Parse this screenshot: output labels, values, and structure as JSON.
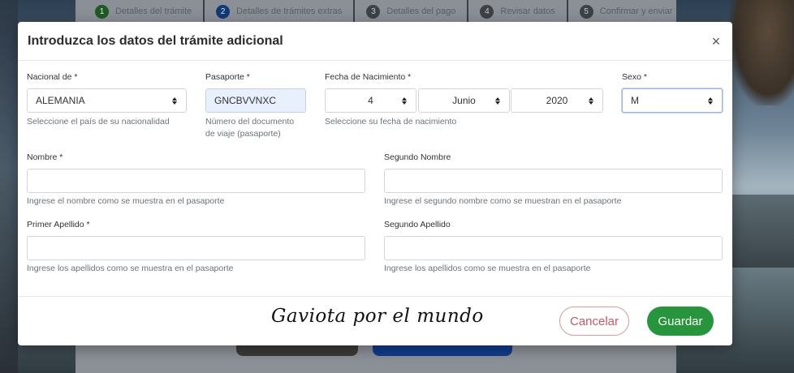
{
  "steps": [
    {
      "num": "1",
      "label": "Detalles del trámite"
    },
    {
      "num": "2",
      "label": "Detalles de trámites extras"
    },
    {
      "num": "3",
      "label": "Detalles del pago"
    },
    {
      "num": "4",
      "label": "Revisar datos"
    },
    {
      "num": "5",
      "label": "Confirmar y enviar"
    }
  ],
  "modal": {
    "title": "Introduzca los datos del trámite adicional",
    "close_symbol": "×"
  },
  "form": {
    "nationality": {
      "label": "Nacional de *",
      "value": "ALEMANIA",
      "help": "Seleccione el país de su nacionalidad"
    },
    "passport": {
      "label": "Pasaporte *",
      "value": "GNCBVVNXC",
      "help_line1": "Número del documento",
      "help_line2": "de viaje (pasaporte)"
    },
    "birthdate": {
      "label": "Fecha de Nacimiento *",
      "day": "4",
      "month": "Junio",
      "year": "2020",
      "help": "Seleccione su fecha de nacimiento"
    },
    "sex": {
      "label": "Sexo *",
      "value": "M"
    },
    "first_name": {
      "label": "Nombre *",
      "value": "",
      "help": "Ingrese el nombre como se muestra en el pasaporte"
    },
    "middle_name": {
      "label": "Segundo Nombre",
      "value": "",
      "help": "Ingrese el segundo nombre como se muestran en el pasaporte"
    },
    "last_name": {
      "label": "Primer Apellido *",
      "value": "",
      "help": "Ingrese los apellidos como se muestra en el pasaporte"
    },
    "second_last_name": {
      "label": "Segundo Apellido",
      "value": "",
      "help": "Ingrese los apellidos como se muestra en el pasaporte"
    }
  },
  "footer": {
    "watermark": "Gaviota por el mundo",
    "cancel_label": "Cancelar",
    "save_label": "Guardar"
  },
  "colors": {
    "save": "#27953b",
    "cancel_text": "#c05a65",
    "filled_input": "#e8f0fd"
  }
}
